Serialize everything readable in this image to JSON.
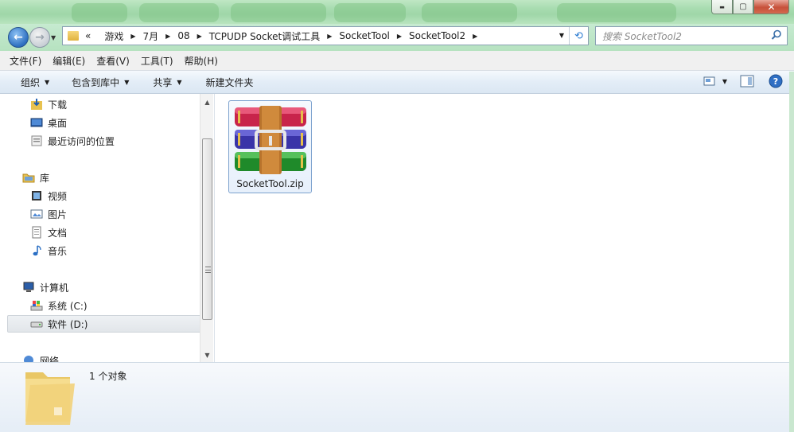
{
  "window": {
    "controls": {
      "minimize": "▬",
      "maximize": "▢",
      "close": "✕"
    }
  },
  "address": {
    "overflow": "«",
    "crumbs": [
      "游戏",
      "7月",
      "08",
      "TCPUDP Socket调试工具",
      "SocketTool",
      "SocketTool2"
    ],
    "search_placeholder": "搜索 SocketTool2"
  },
  "menubar": [
    "文件(F)",
    "编辑(E)",
    "查看(V)",
    "工具(T)",
    "帮助(H)"
  ],
  "toolbar": {
    "organize": "组织",
    "include_in_library": "包含到库中",
    "share": "共享",
    "new_folder": "新建文件夹"
  },
  "navpane": {
    "favorites": [
      {
        "label": "下载",
        "icon": "download-folder-icon"
      },
      {
        "label": "桌面",
        "icon": "desktop-icon"
      },
      {
        "label": "最近访问的位置",
        "icon": "recent-places-icon"
      }
    ],
    "libraries_header": "库",
    "libraries": [
      {
        "label": "视频",
        "icon": "video-library-icon"
      },
      {
        "label": "图片",
        "icon": "pictures-library-icon"
      },
      {
        "label": "文档",
        "icon": "documents-library-icon"
      },
      {
        "label": "音乐",
        "icon": "music-library-icon"
      }
    ],
    "computer_header": "计算机",
    "drives": [
      {
        "label": "系统 (C:)",
        "icon": "system-drive-icon"
      },
      {
        "label": "软件 (D:)",
        "icon": "drive-icon",
        "selected": true
      }
    ],
    "network_header": "网络"
  },
  "files": [
    {
      "name": "SocketTool.zip",
      "icon": "winrar-archive-icon"
    }
  ],
  "status": {
    "count_text": "1 个对象"
  },
  "colors": {
    "title_green": "#a8dcb0",
    "toolbar_blue": "#dbe7f3",
    "selection_border": "#7da2ce"
  }
}
